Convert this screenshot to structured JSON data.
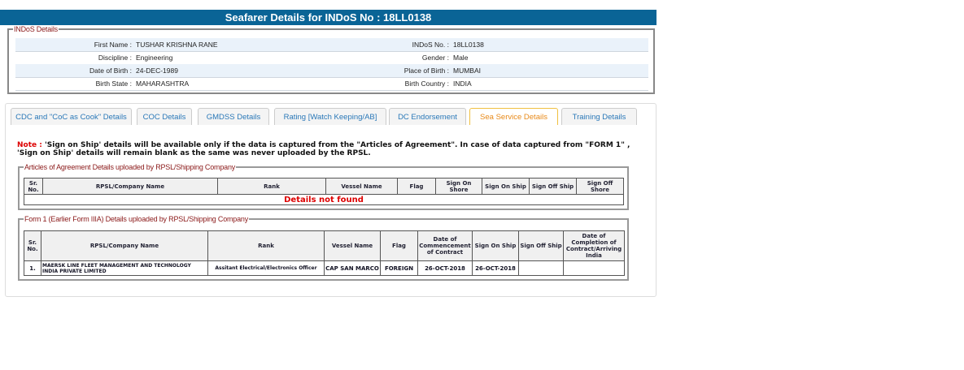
{
  "header": {
    "title": "Seafarer Details for INDoS No : 18LL0138"
  },
  "indos": {
    "legend": "INDoS Details",
    "rows": [
      {
        "l1": "First Name :",
        "v1": "TUSHAR KRISHNA RANE",
        "l2": "INDoS No. :",
        "v2": "18LL0138"
      },
      {
        "l1": "Discipline :",
        "v1": "Engineering",
        "l2": "Gender :",
        "v2": "Male"
      },
      {
        "l1": "Date of Birth :",
        "v1": "24-DEC-1989",
        "l2": "Place of Birth :",
        "v2": "MUMBAI"
      },
      {
        "l1": "Birth State :",
        "v1": "MAHARASHTRA",
        "l2": "Birth Country :",
        "v2": "INDIA"
      }
    ]
  },
  "tabs": [
    "CDC and \"CoC as Cook\" Details",
    "COC Details",
    "GMDSS Details",
    "Rating [Watch Keeping/AB]",
    "DC Endorsement",
    "Sea Service Details",
    "Training Details"
  ],
  "note": {
    "label": "Note :",
    "text": " 'Sign on Ship' details will be available only if the data is captured from the \"Articles of Agreement\". In case of data captured from \"FORM 1\" , 'Sign on Ship' details will remain blank as the same was never uploaded by the RPSL."
  },
  "aoa": {
    "legend": "Articles of Agreement Details uploaded by RPSL/Shipping Company",
    "headers": [
      "Sr. No.",
      "RPSL/Company Name",
      "Rank",
      "Vessel Name",
      "Flag",
      "Sign On Shore",
      "Sign On Ship",
      "Sign Off Ship",
      "Sign Off Shore"
    ],
    "empty": "Details not found"
  },
  "form1": {
    "legend": "Form 1 (Earlier Form IIIA) Details uploaded by RPSL/Shipping Company",
    "headers": [
      "Sr. No.",
      "RPSL/Company Name",
      "Rank",
      "Vessel Name",
      "Flag",
      "Date of Commencement of Contract",
      "Sign On Ship",
      "Sign Off Ship",
      "Date of Completion of Contract/Arriving India"
    ],
    "rows": [
      [
        "1.",
        "MAERSK LINE FLEET MANAGEMENT AND TECHNOLOGY INDIA PRIVATE LIMITED",
        "Assitant Electrical/Electronics Officer",
        "CAP SAN MARCO",
        "FOREIGN",
        "26-OCT-2018",
        "26-OCT-2018",
        "",
        ""
      ]
    ]
  }
}
